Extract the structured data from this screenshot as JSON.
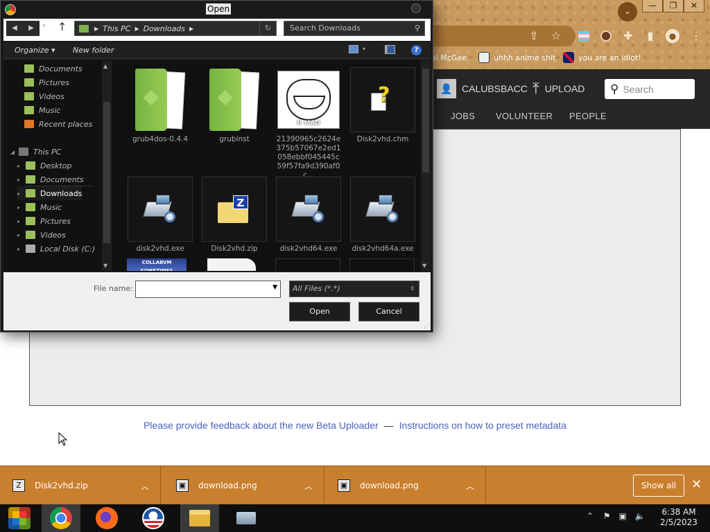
{
  "browser": {
    "bookmarks": [
      {
        "label": "al McGee"
      },
      {
        "label": "uhhh anime shit"
      },
      {
        "label": "you are an idiot!"
      }
    ]
  },
  "site": {
    "username": "CALUBSBACC",
    "upload_label": "UPLOAD",
    "search_placeholder": "Search",
    "nav": [
      "JOBS",
      "VOLUNTEER",
      "PEOPLE"
    ],
    "feedback_link": "Please provide feedback about the new Beta Uploader",
    "separator": "—",
    "instructions_link": "Instructions on how to preset metadata"
  },
  "dialog": {
    "title": "Open",
    "breadcrumb": [
      "This PC",
      "Downloads"
    ],
    "search_placeholder": "Search Downloads",
    "organize": "Organize",
    "new_folder": "New folder",
    "tree": [
      {
        "label": "Documents",
        "color": "#9bbf5a"
      },
      {
        "label": "Pictures",
        "color": "#9bbf5a"
      },
      {
        "label": "Videos",
        "color": "#9bbf5a"
      },
      {
        "label": "Music",
        "color": "#9bbf5a"
      },
      {
        "label": "Recent places",
        "color": "#e0762a"
      },
      {
        "label": "This PC",
        "color": "#777"
      },
      {
        "label": "Desktop",
        "color": "#9bbf5a"
      },
      {
        "label": "Documents",
        "color": "#9bbf5a"
      },
      {
        "label": "Downloads",
        "color": "#9bbf5a"
      },
      {
        "label": "Music",
        "color": "#9bbf5a"
      },
      {
        "label": "Pictures",
        "color": "#9bbf5a"
      },
      {
        "label": "Videos",
        "color": "#9bbf5a"
      },
      {
        "label": "Local Disk (C:)",
        "color": "#aaa"
      }
    ],
    "files": [
      {
        "name": "grub4dos-0.4.4",
        "icon": "folder-icon"
      },
      {
        "name": "grubinst",
        "icon": "folder-icon"
      },
      {
        "name": "21390965c2624e375b57067e2ed1058ebbf045445c59f57fa9d390af0c...",
        "icon": "image-thumbnail-icon",
        "overlay": "U MAD"
      },
      {
        "name": "Disk2vhd.chm",
        "icon": "help-file-icon"
      },
      {
        "name": "disk2vhd.exe",
        "icon": "exe-icon"
      },
      {
        "name": "Disk2vhd.zip",
        "icon": "zip-icon"
      },
      {
        "name": "disk2vhd64.exe",
        "icon": "exe-icon"
      },
      {
        "name": "disk2vhd64a.exe",
        "icon": "exe-icon"
      }
    ],
    "partial_thumb_text": "COLLABVM SOMETIMES",
    "file_name_label": "File name:",
    "file_name_value": "",
    "filter": "All Files (*.*)",
    "open_btn": "Open",
    "cancel_btn": "Cancel"
  },
  "downloads": {
    "items": [
      {
        "name": "Disk2vhd.zip",
        "icon": "zip-icon"
      },
      {
        "name": "download.png",
        "icon": "image-icon"
      },
      {
        "name": "download.png",
        "icon": "image-icon"
      }
    ],
    "show_all": "Show all"
  },
  "taskbar": {
    "time": "6:38 AM",
    "date": "2/5/2023"
  }
}
